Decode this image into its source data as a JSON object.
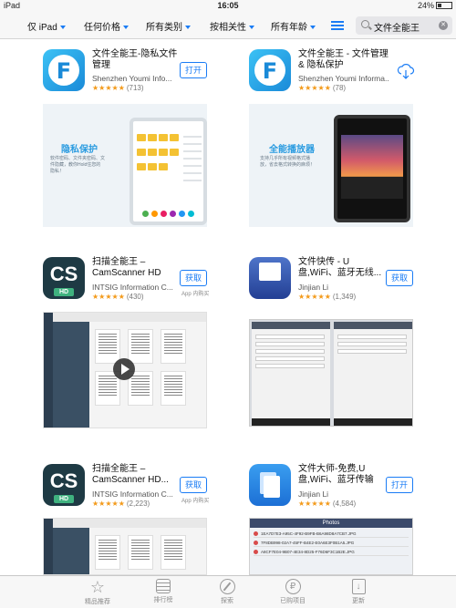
{
  "status": {
    "device": "iPad",
    "time": "16:05",
    "battery": "24%"
  },
  "filters": [
    {
      "label": "仅 iPad"
    },
    {
      "label": "任何价格"
    },
    {
      "label": "所有类别"
    },
    {
      "label": "按相关性"
    },
    {
      "label": "所有年龄"
    }
  ],
  "search": {
    "value": "文件全能王"
  },
  "apps": [
    {
      "name": "文件全能王-隐私文件管理",
      "developer": "Shenzhen Youmi Info...",
      "stars": "★★★★★",
      "ratings": "(713)",
      "action": "打开",
      "sub": ""
    },
    {
      "name": "文件全能王 - 文件管理 & 隐私保护",
      "developer": "Shenzhen Youmi Informa...",
      "stars": "★★★★★",
      "ratings": "(78)",
      "action": "",
      "sub": ""
    },
    {
      "name": "扫描全能王 – CamScanner HD",
      "developer": "INTSIG Information C...",
      "stars": "★★★★★",
      "ratings": "(430)",
      "action": "获取",
      "sub": "App 内购买"
    },
    {
      "name": "文件快传 - U盘,WiFi、蓝牙无线...",
      "developer": "Jinjian Li",
      "stars": "★★★★★",
      "ratings": "(1,349)",
      "action": "获取",
      "sub": ""
    },
    {
      "name": "扫描全能王 – CamScanner HD...",
      "developer": "INTSIG Information C...",
      "stars": "★★★★★",
      "ratings": "(2,223)",
      "action": "获取",
      "sub": "App 内购买"
    },
    {
      "name": "文件大师-免费,U盘,WiFi、蓝牙传输",
      "developer": "Jinjian Li",
      "stars": "★★★★★",
      "ratings": "(4,584)",
      "action": "打开",
      "sub": ""
    }
  ],
  "screenshots": {
    "s1": {
      "title": "隐私保护",
      "desc": "软件密码、文件夹密码、文件隐藏，教你Hold住您的隐私！"
    },
    "s2": {
      "title": "全能播放器",
      "desc": "支持几乎所有视频格式播放，省去格式转换的麻烦！"
    },
    "s5": {
      "title": "Photos"
    }
  },
  "tabs": [
    {
      "label": "精品推荐"
    },
    {
      "label": "排行榜"
    },
    {
      "label": "探索"
    },
    {
      "label": "已购项目"
    },
    {
      "label": "更新"
    }
  ]
}
